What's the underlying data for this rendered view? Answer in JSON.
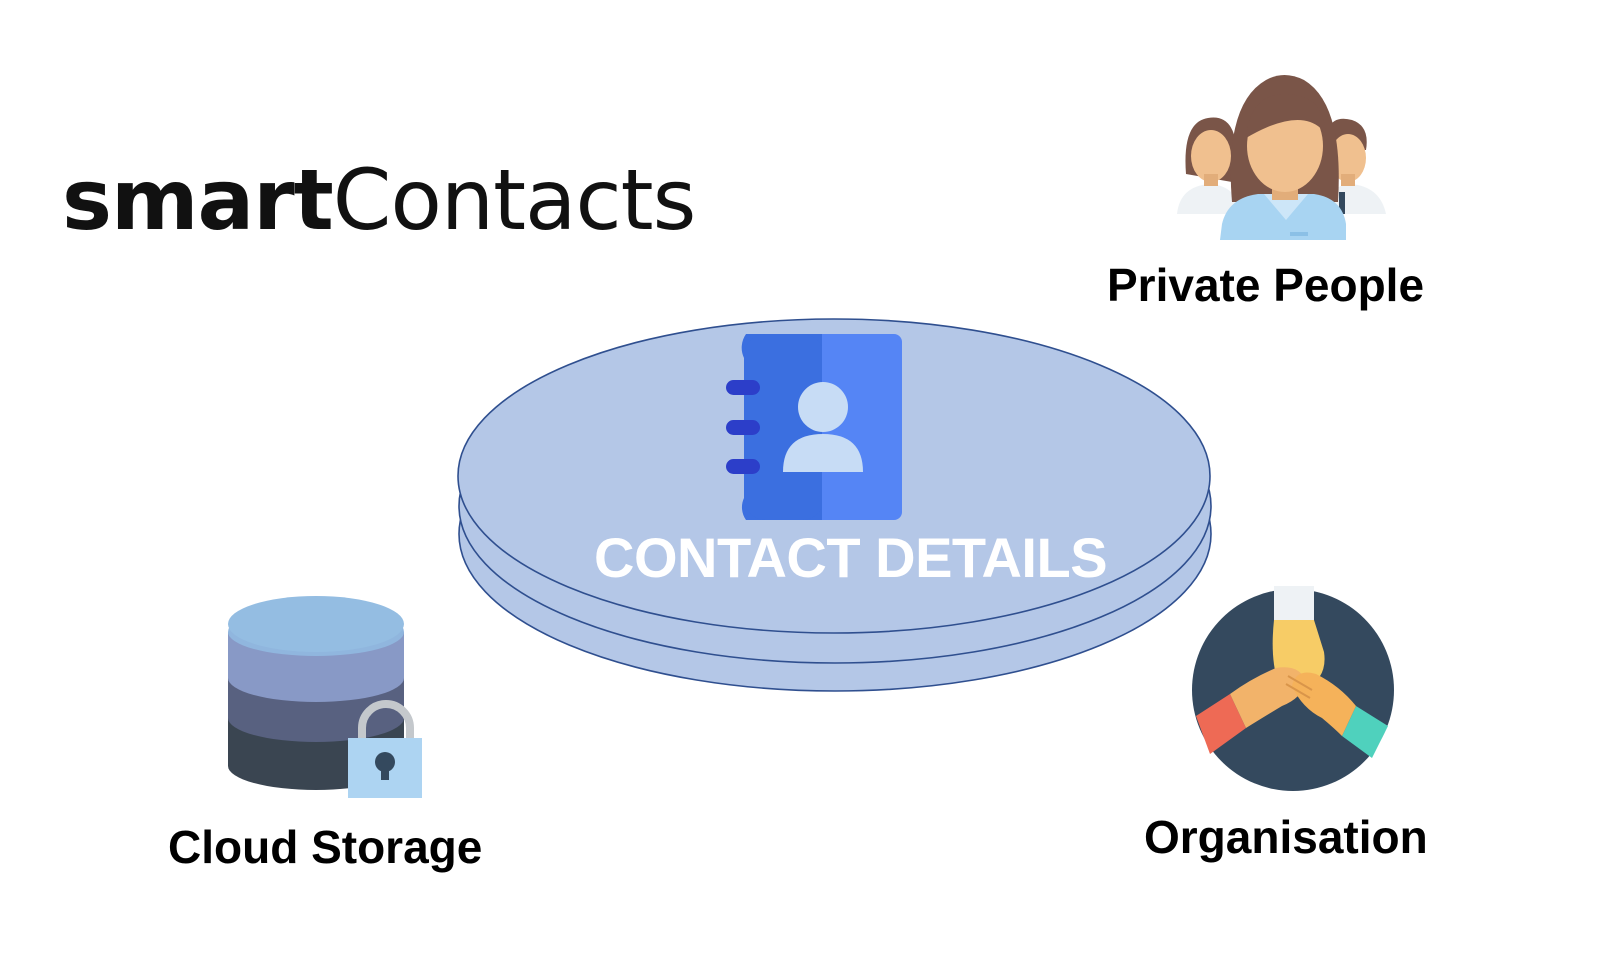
{
  "logo": {
    "bold_part": "smart",
    "light_part": "Contacts"
  },
  "center": {
    "label": "CONTACT DETAILS",
    "icon": "contact-book-icon"
  },
  "nodes": {
    "private_people": {
      "label": "Private People",
      "icon": "people-group-icon"
    },
    "cloud_storage": {
      "label": "Cloud Storage",
      "icon": "locked-database-icon"
    },
    "organisation": {
      "label": "Organisation",
      "icon": "hands-together-icon"
    }
  },
  "colors": {
    "disc_fill": "#b4c7e7",
    "disc_stroke": "#2f4f8f",
    "book_dark": "#3b6fe0",
    "book_light": "#5585f5",
    "org_circle": "#34495e"
  }
}
